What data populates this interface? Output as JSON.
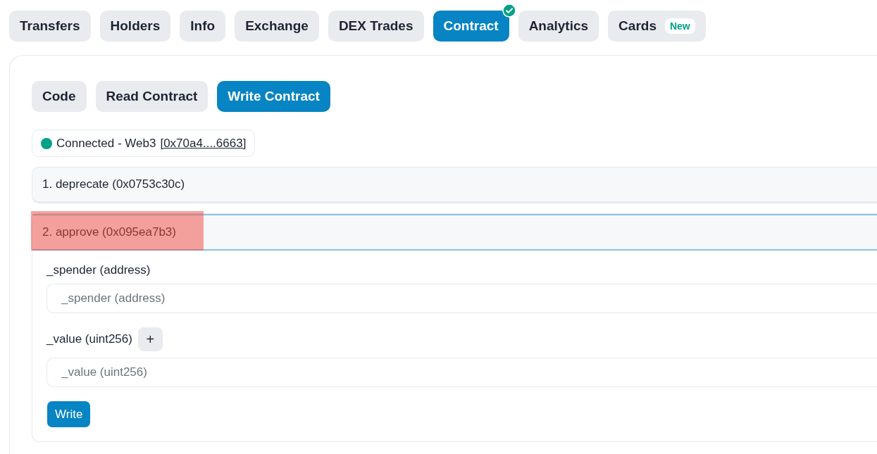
{
  "tabs": [
    {
      "label": "Transfers",
      "selected": false
    },
    {
      "label": "Holders",
      "selected": false
    },
    {
      "label": "Info",
      "selected": false
    },
    {
      "label": "Exchange",
      "selected": false
    },
    {
      "label": "DEX Trades",
      "selected": false
    },
    {
      "label": "Contract",
      "selected": true,
      "verified": true
    },
    {
      "label": "Analytics",
      "selected": false
    },
    {
      "label": "Cards",
      "selected": false,
      "badge": "New"
    }
  ],
  "subtabs": [
    {
      "label": "Code",
      "selected": false
    },
    {
      "label": "Read Contract",
      "selected": false
    },
    {
      "label": "Write Contract",
      "selected": true
    }
  ],
  "connection": {
    "connected": true,
    "status": "Connected - Web3",
    "address": "[0x70a4....6663]"
  },
  "methods": [
    {
      "title": "1. deprecate (0x0753c30c)",
      "expanded": false,
      "highlighted": false
    },
    {
      "title": "2. approve (0x095ea7b3)",
      "expanded": true,
      "highlighted": true,
      "inputs": [
        {
          "label": "_spender (address)",
          "placeholder": "_spender (address)"
        },
        {
          "label": "_value (uint256)",
          "placeholder": "_value (uint256)",
          "expand_button": "+"
        }
      ],
      "button": "Write"
    }
  ]
}
